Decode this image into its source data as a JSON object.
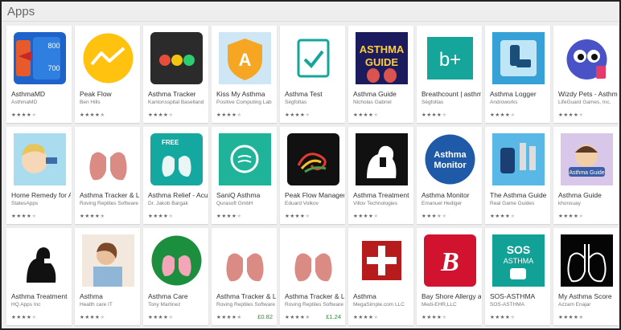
{
  "section_title": "Apps",
  "apps": [
    {
      "title": "AsthmaMD",
      "developer": "AsthmaMD",
      "rating": 4,
      "icon": "asthmamd-gauge-icon",
      "bg": "#1d63c9"
    },
    {
      "title": "Peak Flow",
      "developer": "Ben Hills",
      "rating": 4.5,
      "icon": "peak-flow-line-chart-icon",
      "bg": "#ffc20e"
    },
    {
      "title": "Asthma Tracker",
      "developer": "Kantonsspital Baselland",
      "rating": 4,
      "icon": "traffic-dots-icon",
      "bg": "#2b2b2b"
    },
    {
      "title": "Kiss My Asthma",
      "developer": "Positive Computing Lab",
      "rating": 4,
      "icon": "shield-a-icon",
      "bg": "#f6a623"
    },
    {
      "title": "Asthma Test",
      "developer": "Ségfoltas",
      "rating": 4,
      "icon": "clipboard-check-icon",
      "bg": "#16a59a"
    },
    {
      "title": "Asthma Guide",
      "developer": "Nicholas Gabriel",
      "rating": 4,
      "icon": "asthma-guide-book-icon",
      "bg": "#1b1b5e"
    },
    {
      "title": "Breathcount | asthma",
      "developer": "Ségfoltas",
      "rating": 4,
      "icon": "b-plus-icon",
      "bg": "#16a59a"
    },
    {
      "title": "Asthma Logger",
      "developer": "Androworks",
      "rating": 4,
      "icon": "inhaler-blue-icon",
      "bg": "#36a1d6"
    },
    {
      "title": "Wizdy Pets - Asthma",
      "developer": "LifeGuard Games, Inc.",
      "rating": 4,
      "icon": "wizdy-pet-icon",
      "bg": "#4a52c8"
    },
    {
      "title": "Home Remedy for Asthma",
      "developer": "StatesApps",
      "rating": 4,
      "icon": "girl-inhaler-icon",
      "bg": "#a9dcef"
    },
    {
      "title": "Asthma Tracker & Log",
      "developer": "Roving Reptiles Software",
      "rating": 4.5,
      "icon": "lungs-icon",
      "bg": "#ffffff"
    },
    {
      "title": "Asthma Relief - Acupressure",
      "developer": "Dr. Jakob Bargak",
      "rating": 4,
      "icon": "free-lungs-icon",
      "bg": "#14a8a0"
    },
    {
      "title": "SaniQ Asthma",
      "developer": "Qurasoft GmbH",
      "rating": 4,
      "icon": "saniq-breath-icon",
      "bg": "#1fb49a"
    },
    {
      "title": "Peak Flow Manager",
      "developer": "Eduard Volkov",
      "rating": 4,
      "icon": "swirl-icon",
      "bg": "#111111"
    },
    {
      "title": "Asthma Treatment",
      "developer": "Villov Technologies",
      "rating": 4,
      "icon": "silhouette-inhaler-icon",
      "bg": "#111111"
    },
    {
      "title": "Asthma Monitor",
      "developer": "Emanuel Hediger",
      "rating": 3.5,
      "icon": "asthma-monitor-text-icon",
      "bg": "#1f5aa8"
    },
    {
      "title": "The Asthma Guide",
      "developer": "Real Game Guides",
      "rating": 4,
      "icon": "inhaler-devices-icon",
      "bg": "#5ab8e6"
    },
    {
      "title": "Asthma Guide",
      "developer": "khonsuay",
      "rating": 4,
      "icon": "cartoon-boy-icon",
      "bg": "#d8c7e8"
    },
    {
      "title": "Asthma Treatment",
      "developer": "HQ Apps Inc",
      "rating": 4,
      "icon": "silhouette-inhaler-2-icon",
      "bg": "#ffffff"
    },
    {
      "title": "Asthma",
      "developer": "Health care IT",
      "rating": 4,
      "icon": "coughing-woman-icon",
      "bg": "#f2e8de"
    },
    {
      "title": "Asthma Care",
      "developer": "Tony Martinez",
      "rating": 4,
      "icon": "pink-lungs-icon",
      "bg": "#1c8f3f"
    },
    {
      "title": "Asthma Tracker & Log",
      "developer": "Roving Reptiles Software",
      "rating": 4.5,
      "icon": "lungs-2-icon",
      "bg": "#ffffff",
      "price": "£0.82"
    },
    {
      "title": "Asthma Tracker & Log",
      "developer": "Roving Reptiles Software",
      "rating": 4.5,
      "icon": "lungs-3-icon",
      "bg": "#ffffff",
      "price": "£1.24"
    },
    {
      "title": "Asthma",
      "developer": "MegaSimple.com LLC",
      "rating": 4,
      "icon": "medical-cross-icon",
      "bg": "#b71c1c"
    },
    {
      "title": "Bay Shore Allergy and Asthma",
      "developer": "Medi-EHR,LLC",
      "rating": 4,
      "icon": "letter-b-icon",
      "bg": "#d1132f"
    },
    {
      "title": "SOS-ASTHMA",
      "developer": "SOS-ASTHMA",
      "rating": 4,
      "icon": "sos-asthma-icon",
      "bg": "#11a196"
    },
    {
      "title": "My Asthma Score",
      "developer": "Azzam Enajar",
      "rating": 4.5,
      "icon": "outline-lungs-icon",
      "bg": "#050505"
    }
  ]
}
